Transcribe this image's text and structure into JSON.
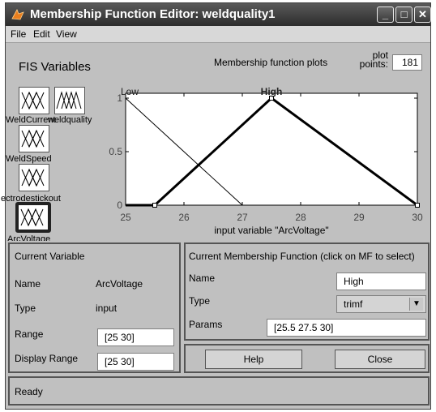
{
  "window": {
    "title": "Membership Function Editor: weldquality1",
    "minimize": "_",
    "maximize": "□",
    "close": "✕"
  },
  "menu": {
    "file": "File",
    "edit": "Edit",
    "view": "View"
  },
  "fis": {
    "title": "FIS Variables",
    "vars": [
      {
        "name": "WeldCurrent",
        "label": "WeldCurrent"
      },
      {
        "name": "weldquality",
        "label": "weldquality"
      },
      {
        "name": "WeldSpeed",
        "label": "WeldSpeed"
      },
      {
        "name": "electrodestickout",
        "label": "ectrodestickout"
      },
      {
        "name": "ArcVoltage",
        "label": "ArcVoltage"
      }
    ]
  },
  "plots": {
    "label": "Membership function plots",
    "points_label": "plot points:",
    "points_value": "181"
  },
  "chart_data": {
    "type": "line",
    "xlabel": "input variable \"ArcVoltage\"",
    "xlim": [
      25,
      30
    ],
    "ylim": [
      0,
      1
    ],
    "x_ticks": [
      "25",
      "26",
      "27",
      "28",
      "29",
      "30"
    ],
    "y_ticks": [
      "0",
      "0.5",
      "1"
    ],
    "series": [
      {
        "name": "Low",
        "points": [
          [
            25,
            1
          ],
          [
            27,
            0
          ],
          [
            30,
            0
          ]
        ],
        "selected": false
      },
      {
        "name": "High",
        "points": [
          [
            25,
            0
          ],
          [
            25.5,
            0
          ],
          [
            27.5,
            1
          ],
          [
            30,
            0
          ]
        ],
        "selected": true
      }
    ]
  },
  "current_variable": {
    "header": "Current Variable",
    "name_label": "Name",
    "name_value": "ArcVoltage",
    "type_label": "Type",
    "type_value": "input",
    "range_label": "Range",
    "range_value": "[25 30]",
    "display_range_label": "Display Range",
    "display_range_value": "[25 30]"
  },
  "current_mf": {
    "header": "Current Membership Function (click on MF to select)",
    "name_label": "Name",
    "name_value": "High",
    "type_label": "Type",
    "type_value": "trimf",
    "params_label": "Params",
    "params_value": "[25.5 27.5 30]"
  },
  "buttons": {
    "help": "Help",
    "close": "Close"
  },
  "status": "Ready"
}
